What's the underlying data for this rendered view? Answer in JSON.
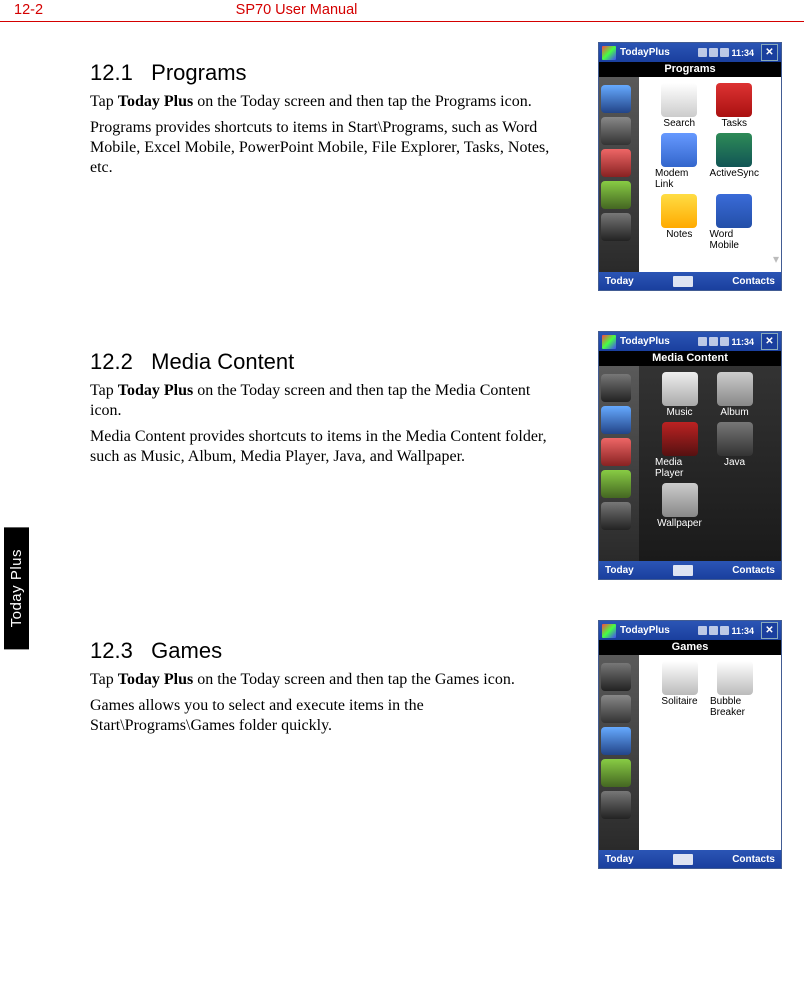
{
  "header": {
    "page_num": "12-2",
    "doc_title": "SP70 User Manual"
  },
  "side_tab": "Today Plus",
  "sections": {
    "s1": {
      "heading_num": "12.1",
      "heading_title": "Programs",
      "p1_pre": "Tap ",
      "p1_bold": "Today Plus",
      "p1_post": " on the Today screen and then tap the Programs icon.",
      "p2": "Programs provides shortcuts to items in Start\\Programs, such as Word Mobile, Excel Mobile, PowerPoint Mobile, File Explorer, Tasks, Notes, etc."
    },
    "s2": {
      "heading_num": "12.2",
      "heading_title": "Media Content",
      "p1_pre": "Tap ",
      "p1_bold": "Today Plus",
      "p1_post": " on the Today screen and then tap the Media Content icon.",
      "p2": "Media Content provides shortcuts to items in the Media Content folder, such as Music, Album, Media Player, Java, and Wallpaper."
    },
    "s3": {
      "heading_num": "12.3",
      "heading_title": "Games",
      "p1_pre": "Tap ",
      "p1_bold": "Today Plus",
      "p1_post": " on the Today screen and then tap the Games icon.",
      "p2": "Games allows you to select and execute items in the Start\\Programs\\Games folder quickly."
    }
  },
  "phones": {
    "common": {
      "top_label": "TodayPlus",
      "time": "11:34",
      "bottom_left": "Today",
      "bottom_right": "Contacts"
    },
    "p1": {
      "title": "Programs",
      "apps": [
        {
          "label": "Search",
          "cls": "ic-search"
        },
        {
          "label": "Tasks",
          "cls": "ic-tasks"
        },
        {
          "label": "Modem Link",
          "cls": "ic-modem"
        },
        {
          "label": "ActiveSync",
          "cls": "ic-sync"
        },
        {
          "label": "Notes",
          "cls": "ic-notes"
        },
        {
          "label": "Word Mobile",
          "cls": "ic-word"
        }
      ]
    },
    "p2": {
      "title": "Media Content",
      "apps": [
        {
          "label": "Music",
          "cls": "ic-music"
        },
        {
          "label": "Album",
          "cls": "ic-album"
        },
        {
          "label": "Media Player",
          "cls": "ic-mplayer"
        },
        {
          "label": "Java",
          "cls": "ic-java"
        },
        {
          "label": "Wallpaper",
          "cls": "ic-wall"
        }
      ]
    },
    "p3": {
      "title": "Games",
      "apps": [
        {
          "label": "Solitaire",
          "cls": "ic-solitaire"
        },
        {
          "label": "Bubble Breaker",
          "cls": "ic-bubble"
        }
      ]
    }
  }
}
